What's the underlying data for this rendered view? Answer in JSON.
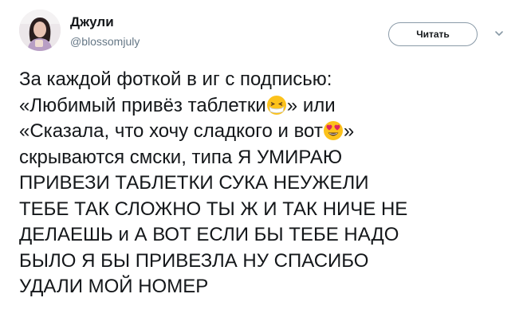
{
  "author": {
    "display_name": "Джули",
    "handle": "@blossomjuly"
  },
  "follow_button_label": "Читать",
  "more_menu_icon": "chevron-down-icon",
  "tweet": {
    "lines": [
      {
        "text": "За каждой фоткой в иг с подписью:"
      },
      {
        "before": "«Любимый привёз таблетки",
        "emoji": "sick-face-emoji",
        "after": "» или"
      },
      {
        "before": "«Сказала, что хочу сладкого и вот",
        "emoji": "heart-eyes-emoji",
        "after": "»"
      },
      {
        "text": "скрываются смски, типа Я УМИРАЮ"
      },
      {
        "text": "ПРИВЕЗИ ТАБЛЕТКИ СУКА НЕУЖЕЛИ"
      },
      {
        "text": "ТЕБЕ ТАК СЛОЖНО ТЫ Ж И ТАК НИЧЕ НЕ"
      },
      {
        "text": "ДЕЛАЕШЬ и А ВОТ ЕСЛИ БЫ ТЕБЕ НАДО"
      },
      {
        "text": "БЫЛО Я БЫ ПРИВЕЗЛА НУ СПАСИБО"
      },
      {
        "text": "УДАЛИ МОЙ НОМЕР"
      }
    ]
  },
  "colors": {
    "text": "#14171a",
    "secondary_text": "#657786",
    "button_border": "#8a9aa8",
    "emoji_yellow": "#fcc21b",
    "heart_red": "#e0245e"
  }
}
